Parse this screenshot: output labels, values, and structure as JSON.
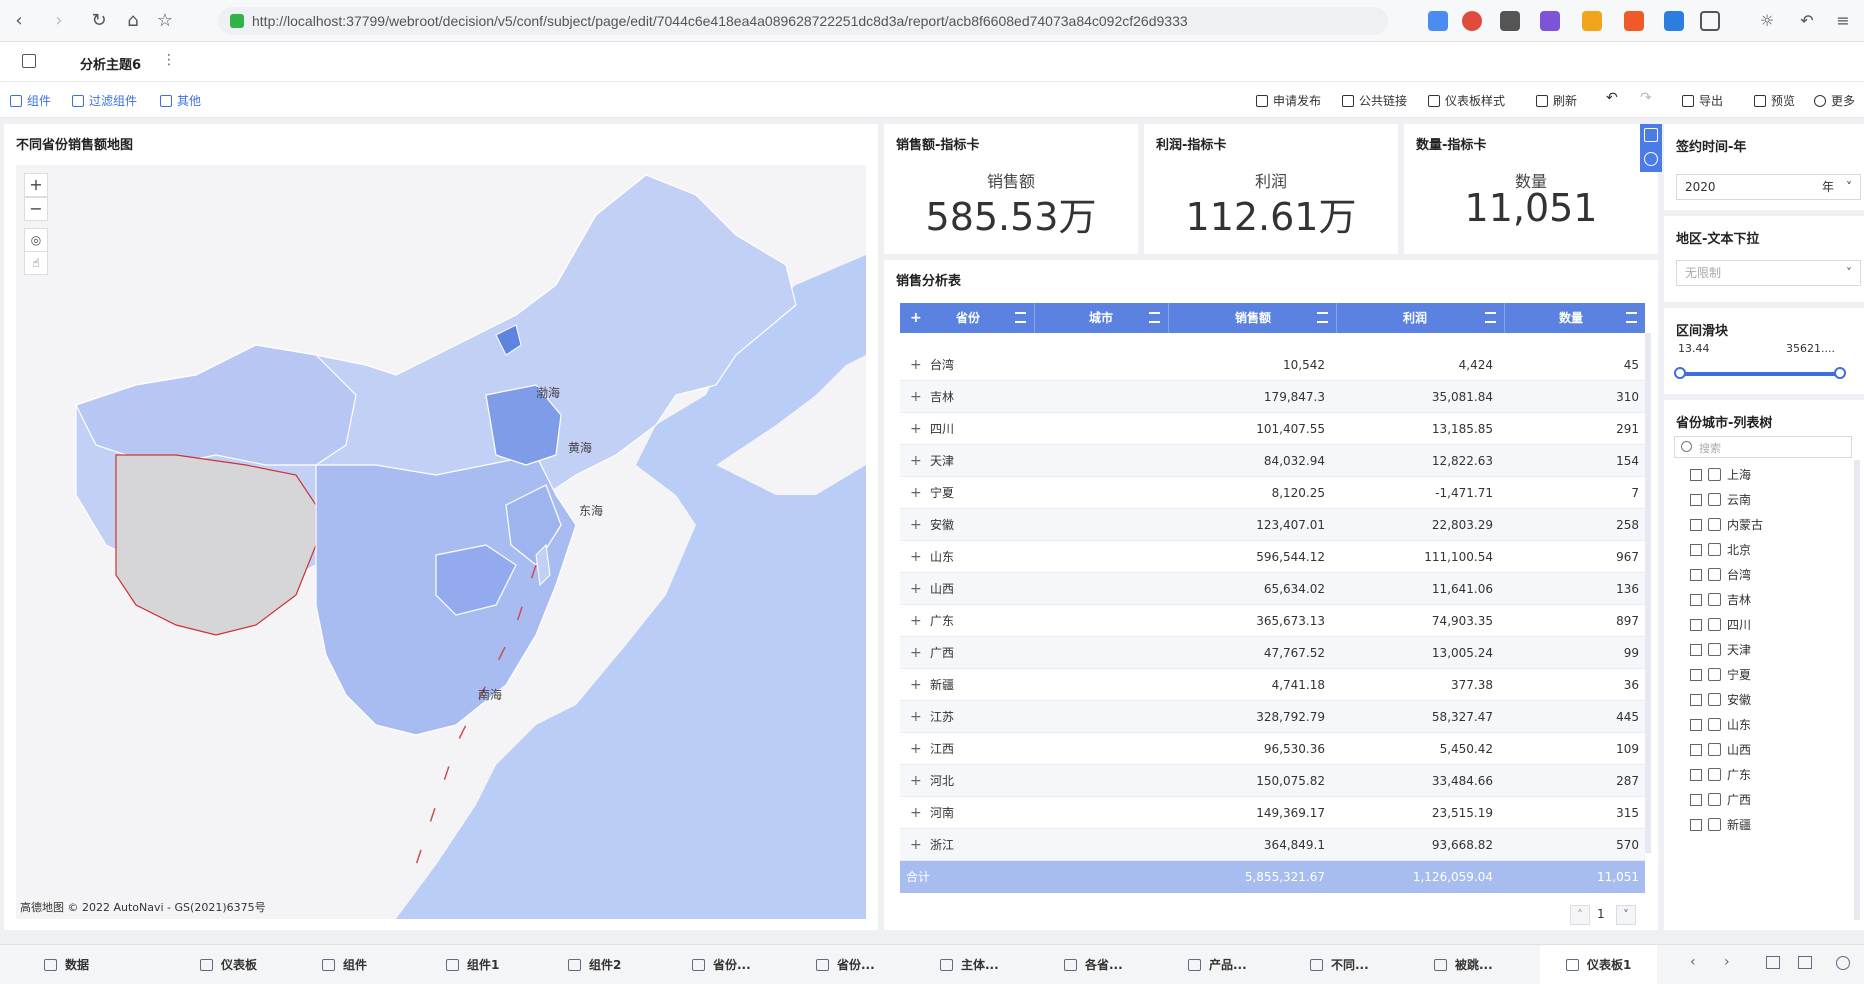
{
  "browser": {
    "url": "http://localhost:37799/webroot/decision/v5/conf/subject/page/edit/7044c6e418ea4a089628722251dc8d3a/report/acb8f6608ed74073a84c092cf26d9333"
  },
  "app": {
    "tab_title": "分析主题6"
  },
  "toolbar": {
    "left": [
      "组件",
      "过滤组件",
      "其他"
    ],
    "right": [
      "申请发布",
      "公共链接",
      "仪表板样式",
      "刷新",
      "导出",
      "预览",
      "更多"
    ]
  },
  "map": {
    "title": "不同省份销售额地图",
    "labels": {
      "bohai": "渤海",
      "huanghai": "黄海",
      "donghai": "东海",
      "nanhai": "南海"
    },
    "attribution": "高德地图 © 2022 AutoNavi - GS(2021)6375号"
  },
  "kpis": [
    {
      "title": "销售额-指标卡",
      "label": "销售额",
      "value": "585.53万"
    },
    {
      "title": "利润-指标卡",
      "label": "利润",
      "value": "112.61万"
    },
    {
      "title": "数量-指标卡",
      "label": "数量",
      "value": "11,051"
    }
  ],
  "table": {
    "title": "销售分析表",
    "columns": [
      "省份",
      "城市",
      "销售额",
      "利润",
      "数量"
    ],
    "rows": [
      [
        "台湾",
        "10,542",
        "4,424",
        "45"
      ],
      [
        "吉林",
        "179,847.3",
        "35,081.84",
        "310"
      ],
      [
        "四川",
        "101,407.55",
        "13,185.85",
        "291"
      ],
      [
        "天津",
        "84,032.94",
        "12,822.63",
        "154"
      ],
      [
        "宁夏",
        "8,120.25",
        "-1,471.71",
        "7"
      ],
      [
        "安徽",
        "123,407.01",
        "22,803.29",
        "258"
      ],
      [
        "山东",
        "596,544.12",
        "111,100.54",
        "967"
      ],
      [
        "山西",
        "65,634.02",
        "11,641.06",
        "136"
      ],
      [
        "广东",
        "365,673.13",
        "74,903.35",
        "897"
      ],
      [
        "广西",
        "47,767.52",
        "13,005.24",
        "99"
      ],
      [
        "新疆",
        "4,741.18",
        "377.38",
        "36"
      ],
      [
        "江苏",
        "328,792.79",
        "58,327.47",
        "445"
      ],
      [
        "江西",
        "96,530.36",
        "5,450.42",
        "109"
      ],
      [
        "河北",
        "150,075.82",
        "33,484.66",
        "287"
      ],
      [
        "河南",
        "149,369.17",
        "23,515.19",
        "315"
      ],
      [
        "浙江",
        "364,849.1",
        "93,668.82",
        "570"
      ]
    ],
    "footer": {
      "label": "合计",
      "sales": "5,855,321.67",
      "profit": "1,126,059.04",
      "qty": "11,051"
    },
    "page": "1"
  },
  "filters": {
    "year": {
      "title": "签约时间-年",
      "value": "2020",
      "unit": "年"
    },
    "region": {
      "title": "地区-文本下拉",
      "placeholder": "无限制"
    },
    "slider": {
      "title": "区间滑块",
      "min": "13.44",
      "max": "35621...."
    },
    "tree": {
      "title": "省份城市-列表树",
      "search_placeholder": "搜索",
      "items": [
        "上海",
        "云南",
        "内蒙古",
        "北京",
        "台湾",
        "吉林",
        "四川",
        "天津",
        "宁夏",
        "安徽",
        "山东",
        "山西",
        "广东",
        "广西",
        "新疆"
      ]
    }
  },
  "bottom_tabs": [
    "数据",
    "仪表板",
    "组件",
    "组件1",
    "组件2",
    "省份...",
    "省份...",
    "主体...",
    "各省...",
    "产品...",
    "不同...",
    "被跳...",
    "仪表板1"
  ],
  "colors": {
    "accent": "#3b6fe0",
    "header": "#5b82e0",
    "footer": "#a7bcef",
    "map_sea": "#b9cdf7"
  }
}
